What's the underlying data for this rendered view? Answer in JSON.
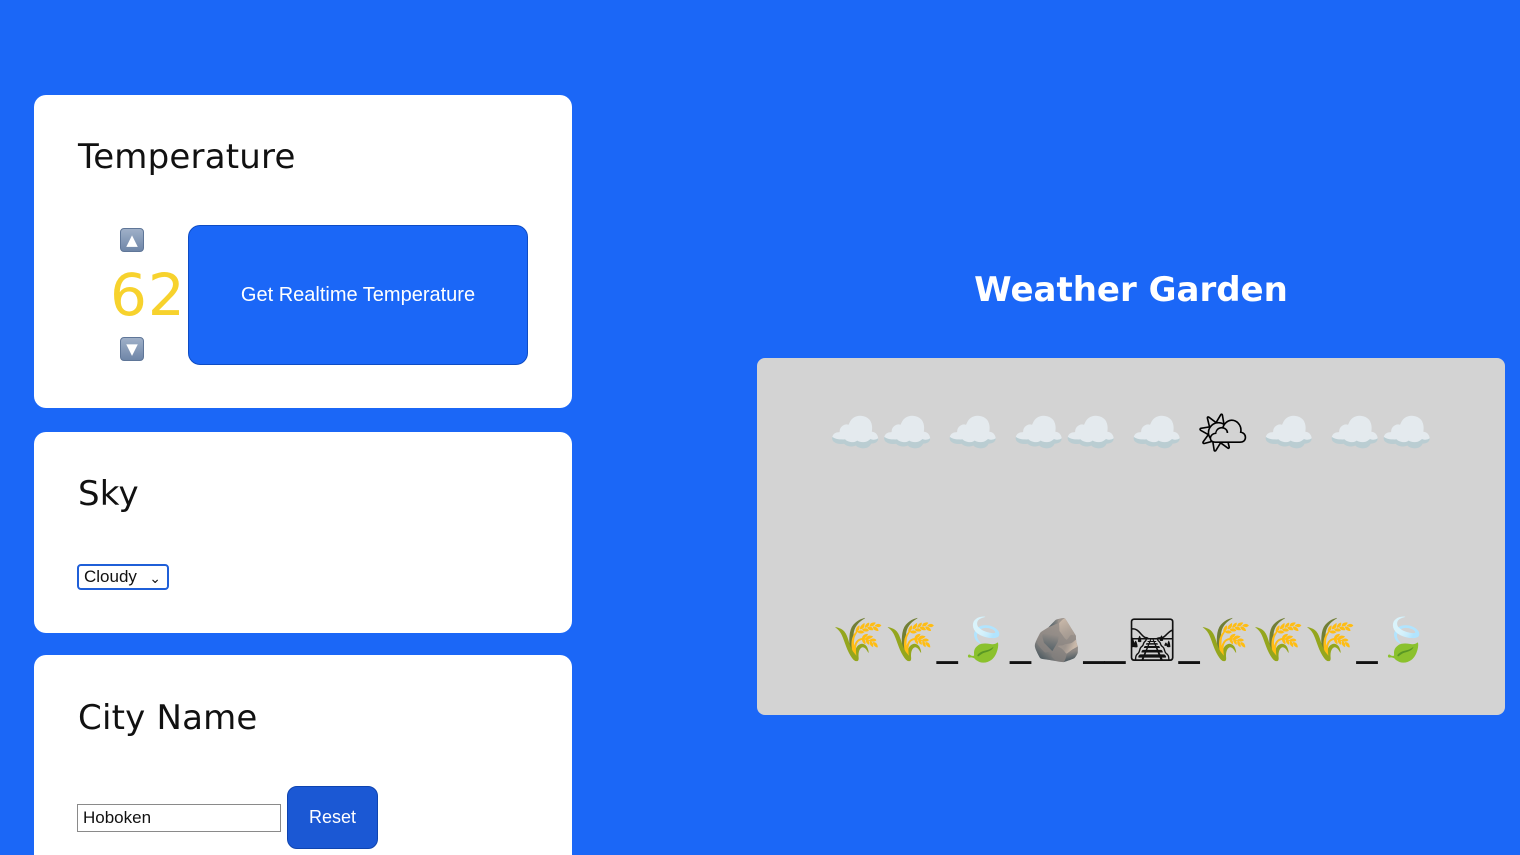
{
  "temperature": {
    "title": "Temperature",
    "value": "62",
    "up_icon": "⬆️",
    "down_icon": "⬇️",
    "realtime_button_label": "Get Realtime Temperature",
    "value_color": "#f7d22d"
  },
  "sky": {
    "title": "Sky",
    "selected": "Cloudy"
  },
  "city": {
    "title": "City Name",
    "input_value": "Hoboken",
    "reset_label": "Reset"
  },
  "garden": {
    "title": "Weather Garden",
    "sky_row": "☁️☁️ ☁️ ☁️☁️ ☁️ 🌤 ☁️ ☁️☁️",
    "landscape_row": "🌾🌾_🍃_🪨__🛤_🌾🌾🌾_🍃"
  },
  "colors": {
    "background": "#1b67f7",
    "card": "#ffffff",
    "garden_box": "#d3d3d3"
  }
}
